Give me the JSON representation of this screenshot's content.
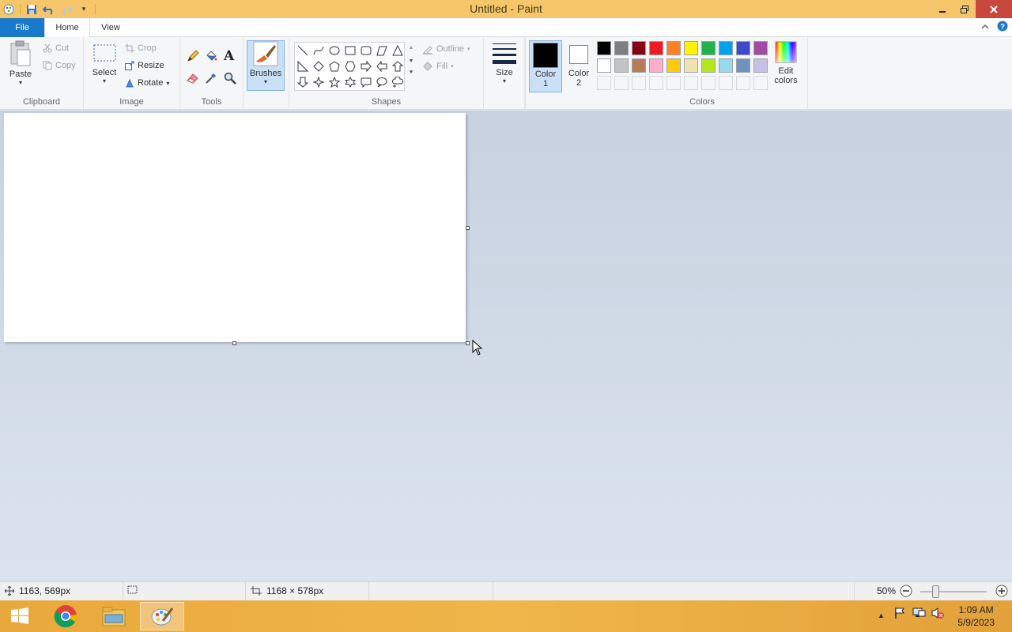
{
  "window": {
    "title": "Untitled - Paint",
    "quick_access": [
      "paint-menu-icon",
      "save-icon",
      "undo-icon",
      "redo-icon",
      "customize-qat-icon"
    ]
  },
  "tabs": {
    "file": "File",
    "home": "Home",
    "view": "View"
  },
  "ribbon": {
    "clipboard": {
      "label": "Clipboard",
      "paste": "Paste",
      "cut": "Cut",
      "copy": "Copy"
    },
    "image": {
      "label": "Image",
      "select": "Select",
      "crop": "Crop",
      "resize": "Resize",
      "rotate": "Rotate"
    },
    "tools": {
      "label": "Tools"
    },
    "brushes": {
      "label": "Brushes"
    },
    "shapes": {
      "label": "Shapes",
      "outline": "Outline",
      "fill": "Fill"
    },
    "size": {
      "label": "Size"
    },
    "color1": {
      "line1": "Color",
      "line2": "1",
      "value": "#000000"
    },
    "color2": {
      "line1": "Color",
      "line2": "2",
      "value": "#ffffff"
    },
    "colors": {
      "label": "Colors",
      "edit_line1": "Edit",
      "edit_line2": "colors",
      "row1": [
        "#000000",
        "#7f7f7f",
        "#880015",
        "#ed1c24",
        "#ff7f27",
        "#fff200",
        "#22b14c",
        "#00a2e8",
        "#3f48cc",
        "#a349a4"
      ],
      "row2": [
        "#ffffff",
        "#c3c3c3",
        "#b97a57",
        "#ffaec9",
        "#ffc90e",
        "#efe4b0",
        "#b5e61d",
        "#99d9ea",
        "#7092be",
        "#c8bfe7"
      ],
      "row3": [
        "#f5f6f7",
        "#f5f6f7",
        "#f5f6f7",
        "#f5f6f7",
        "#f5f6f7",
        "#f5f6f7",
        "#f5f6f7",
        "#f5f6f7",
        "#f5f6f7",
        "#f5f6f7"
      ]
    }
  },
  "status": {
    "cursor_position": "1163, 569px",
    "selection_size": "",
    "canvas_size": "1168 × 578px",
    "zoom": "50%"
  },
  "taskbar": {
    "time": "1:09 AM",
    "date": "5/9/2023"
  }
}
